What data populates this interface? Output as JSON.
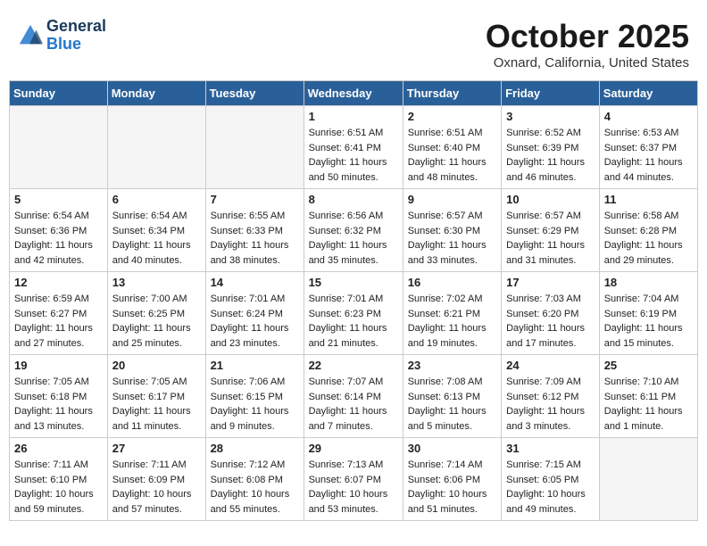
{
  "header": {
    "logo_line1": "General",
    "logo_line2": "Blue",
    "month": "October 2025",
    "location": "Oxnard, California, United States"
  },
  "weekdays": [
    "Sunday",
    "Monday",
    "Tuesday",
    "Wednesday",
    "Thursday",
    "Friday",
    "Saturday"
  ],
  "weeks": [
    [
      {
        "day": "",
        "sunrise": "",
        "sunset": "",
        "daylight": ""
      },
      {
        "day": "",
        "sunrise": "",
        "sunset": "",
        "daylight": ""
      },
      {
        "day": "",
        "sunrise": "",
        "sunset": "",
        "daylight": ""
      },
      {
        "day": "1",
        "sunrise": "Sunrise: 6:51 AM",
        "sunset": "Sunset: 6:41 PM",
        "daylight": "Daylight: 11 hours and 50 minutes."
      },
      {
        "day": "2",
        "sunrise": "Sunrise: 6:51 AM",
        "sunset": "Sunset: 6:40 PM",
        "daylight": "Daylight: 11 hours and 48 minutes."
      },
      {
        "day": "3",
        "sunrise": "Sunrise: 6:52 AM",
        "sunset": "Sunset: 6:39 PM",
        "daylight": "Daylight: 11 hours and 46 minutes."
      },
      {
        "day": "4",
        "sunrise": "Sunrise: 6:53 AM",
        "sunset": "Sunset: 6:37 PM",
        "daylight": "Daylight: 11 hours and 44 minutes."
      }
    ],
    [
      {
        "day": "5",
        "sunrise": "Sunrise: 6:54 AM",
        "sunset": "Sunset: 6:36 PM",
        "daylight": "Daylight: 11 hours and 42 minutes."
      },
      {
        "day": "6",
        "sunrise": "Sunrise: 6:54 AM",
        "sunset": "Sunset: 6:34 PM",
        "daylight": "Daylight: 11 hours and 40 minutes."
      },
      {
        "day": "7",
        "sunrise": "Sunrise: 6:55 AM",
        "sunset": "Sunset: 6:33 PM",
        "daylight": "Daylight: 11 hours and 38 minutes."
      },
      {
        "day": "8",
        "sunrise": "Sunrise: 6:56 AM",
        "sunset": "Sunset: 6:32 PM",
        "daylight": "Daylight: 11 hours and 35 minutes."
      },
      {
        "day": "9",
        "sunrise": "Sunrise: 6:57 AM",
        "sunset": "Sunset: 6:30 PM",
        "daylight": "Daylight: 11 hours and 33 minutes."
      },
      {
        "day": "10",
        "sunrise": "Sunrise: 6:57 AM",
        "sunset": "Sunset: 6:29 PM",
        "daylight": "Daylight: 11 hours and 31 minutes."
      },
      {
        "day": "11",
        "sunrise": "Sunrise: 6:58 AM",
        "sunset": "Sunset: 6:28 PM",
        "daylight": "Daylight: 11 hours and 29 minutes."
      }
    ],
    [
      {
        "day": "12",
        "sunrise": "Sunrise: 6:59 AM",
        "sunset": "Sunset: 6:27 PM",
        "daylight": "Daylight: 11 hours and 27 minutes."
      },
      {
        "day": "13",
        "sunrise": "Sunrise: 7:00 AM",
        "sunset": "Sunset: 6:25 PM",
        "daylight": "Daylight: 11 hours and 25 minutes."
      },
      {
        "day": "14",
        "sunrise": "Sunrise: 7:01 AM",
        "sunset": "Sunset: 6:24 PM",
        "daylight": "Daylight: 11 hours and 23 minutes."
      },
      {
        "day": "15",
        "sunrise": "Sunrise: 7:01 AM",
        "sunset": "Sunset: 6:23 PM",
        "daylight": "Daylight: 11 hours and 21 minutes."
      },
      {
        "day": "16",
        "sunrise": "Sunrise: 7:02 AM",
        "sunset": "Sunset: 6:21 PM",
        "daylight": "Daylight: 11 hours and 19 minutes."
      },
      {
        "day": "17",
        "sunrise": "Sunrise: 7:03 AM",
        "sunset": "Sunset: 6:20 PM",
        "daylight": "Daylight: 11 hours and 17 minutes."
      },
      {
        "day": "18",
        "sunrise": "Sunrise: 7:04 AM",
        "sunset": "Sunset: 6:19 PM",
        "daylight": "Daylight: 11 hours and 15 minutes."
      }
    ],
    [
      {
        "day": "19",
        "sunrise": "Sunrise: 7:05 AM",
        "sunset": "Sunset: 6:18 PM",
        "daylight": "Daylight: 11 hours and 13 minutes."
      },
      {
        "day": "20",
        "sunrise": "Sunrise: 7:05 AM",
        "sunset": "Sunset: 6:17 PM",
        "daylight": "Daylight: 11 hours and 11 minutes."
      },
      {
        "day": "21",
        "sunrise": "Sunrise: 7:06 AM",
        "sunset": "Sunset: 6:15 PM",
        "daylight": "Daylight: 11 hours and 9 minutes."
      },
      {
        "day": "22",
        "sunrise": "Sunrise: 7:07 AM",
        "sunset": "Sunset: 6:14 PM",
        "daylight": "Daylight: 11 hours and 7 minutes."
      },
      {
        "day": "23",
        "sunrise": "Sunrise: 7:08 AM",
        "sunset": "Sunset: 6:13 PM",
        "daylight": "Daylight: 11 hours and 5 minutes."
      },
      {
        "day": "24",
        "sunrise": "Sunrise: 7:09 AM",
        "sunset": "Sunset: 6:12 PM",
        "daylight": "Daylight: 11 hours and 3 minutes."
      },
      {
        "day": "25",
        "sunrise": "Sunrise: 7:10 AM",
        "sunset": "Sunset: 6:11 PM",
        "daylight": "Daylight: 11 hours and 1 minute."
      }
    ],
    [
      {
        "day": "26",
        "sunrise": "Sunrise: 7:11 AM",
        "sunset": "Sunset: 6:10 PM",
        "daylight": "Daylight: 10 hours and 59 minutes."
      },
      {
        "day": "27",
        "sunrise": "Sunrise: 7:11 AM",
        "sunset": "Sunset: 6:09 PM",
        "daylight": "Daylight: 10 hours and 57 minutes."
      },
      {
        "day": "28",
        "sunrise": "Sunrise: 7:12 AM",
        "sunset": "Sunset: 6:08 PM",
        "daylight": "Daylight: 10 hours and 55 minutes."
      },
      {
        "day": "29",
        "sunrise": "Sunrise: 7:13 AM",
        "sunset": "Sunset: 6:07 PM",
        "daylight": "Daylight: 10 hours and 53 minutes."
      },
      {
        "day": "30",
        "sunrise": "Sunrise: 7:14 AM",
        "sunset": "Sunset: 6:06 PM",
        "daylight": "Daylight: 10 hours and 51 minutes."
      },
      {
        "day": "31",
        "sunrise": "Sunrise: 7:15 AM",
        "sunset": "Sunset: 6:05 PM",
        "daylight": "Daylight: 10 hours and 49 minutes."
      },
      {
        "day": "",
        "sunrise": "",
        "sunset": "",
        "daylight": ""
      }
    ]
  ]
}
